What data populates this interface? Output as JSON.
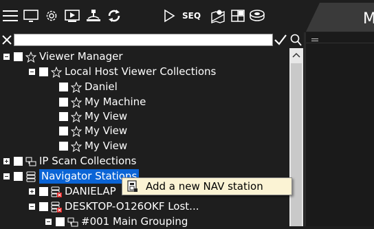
{
  "toolbar": {
    "icons": [
      "menu-icon",
      "monitor-icon",
      "settings-gear-icon",
      "play-screen-icon",
      "network-tree-icon",
      "refresh-icon",
      "play-icon",
      "seq-icon",
      "map-icon",
      "layout-grid-icon",
      "database-icon"
    ],
    "seq_label": "SEQ"
  },
  "right_tab": {
    "label": "M"
  },
  "filter": {
    "value": "",
    "placeholder": ""
  },
  "tree": [
    {
      "label": "Viewer Manager",
      "icon": "star-icon",
      "expander": "minus"
    },
    {
      "label": "Local Host Viewer Collections",
      "icon": "star-icon",
      "expander": "minus"
    },
    {
      "label": "Daniel",
      "icon": "star-icon"
    },
    {
      "label": "My Machine",
      "icon": "star-icon"
    },
    {
      "label": "My View",
      "icon": "star-icon"
    },
    {
      "label": "My View",
      "icon": "star-icon"
    },
    {
      "label": "My View",
      "icon": "star-icon"
    },
    {
      "label": "IP Scan Collections",
      "icon": "network-icon",
      "expander": "plus"
    },
    {
      "label": "Navigator Stations",
      "icon": "server-icon",
      "expander": "minus",
      "selected": true
    },
    {
      "label": "DANIELAP",
      "icon": "server-error-icon",
      "expander": "plus"
    },
    {
      "label": "DESKTOP-O126OKF Lost...",
      "icon": "server-error-icon",
      "expander": "minus"
    },
    {
      "label": "#001 Main Grouping",
      "icon": "network-icon",
      "expander": "minus"
    }
  ],
  "context_menu": {
    "items": [
      {
        "label": "Add a new NAV station",
        "icon": "add-station-icon"
      }
    ]
  },
  "colors": {
    "background": "#1e1e1e",
    "selected": "#0a64d6",
    "menu_bg": "#fbf3d4"
  }
}
